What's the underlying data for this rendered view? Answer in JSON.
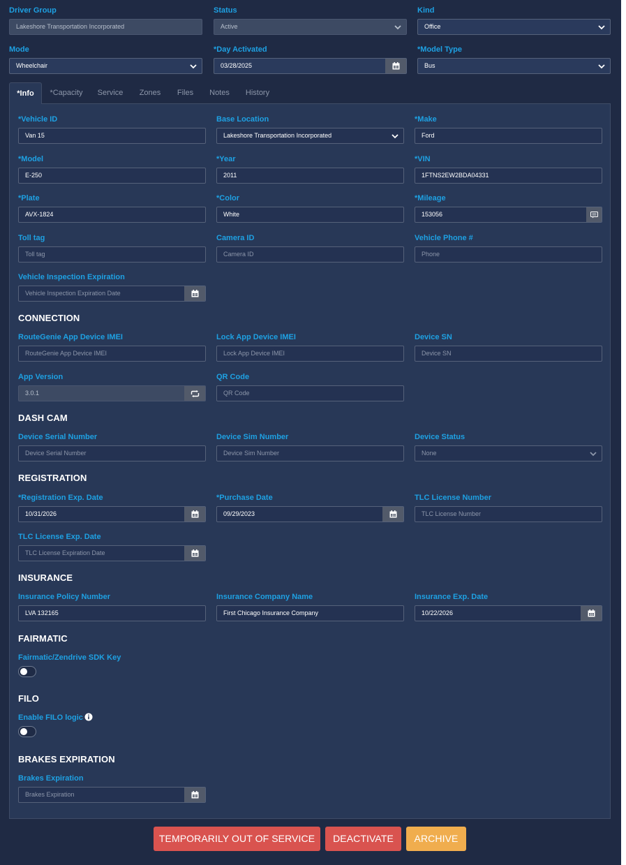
{
  "top": {
    "driver_group": {
      "label": "Driver Group",
      "value": "Lakeshore Transportation Incorporated"
    },
    "status": {
      "label": "Status",
      "value": "Active"
    },
    "kind": {
      "label": "Kind",
      "value": "Office"
    },
    "mode": {
      "label": "Mode",
      "value": "Wheelchair"
    },
    "day_activated": {
      "label": "*Day Activated",
      "value": "03/28/2025"
    },
    "model_type": {
      "label": "*Model Type",
      "value": "Bus"
    }
  },
  "tabs": [
    "*Info",
    "*Capacity",
    "Service",
    "Zones",
    "Files",
    "Notes",
    "History"
  ],
  "info": {
    "vehicle_id": {
      "label": "*Vehicle ID",
      "value": "Van 15"
    },
    "base_location": {
      "label": "Base Location",
      "value": "Lakeshore Transportation Incorporated"
    },
    "make": {
      "label": "*Make",
      "value": "Ford"
    },
    "model": {
      "label": "*Model",
      "value": "E-250"
    },
    "year": {
      "label": "*Year",
      "value": "2011"
    },
    "vin": {
      "label": "*VIN",
      "value": "1FTNS2EW2BDA04331"
    },
    "plate": {
      "label": "*Plate",
      "value": "AVX-1824"
    },
    "color": {
      "label": "*Color",
      "value": "White"
    },
    "mileage": {
      "label": "*Mileage",
      "value": "153056"
    },
    "toll_tag": {
      "label": "Toll tag",
      "placeholder": "Toll tag"
    },
    "camera_id": {
      "label": "Camera ID",
      "placeholder": "Camera ID"
    },
    "vehicle_phone": {
      "label": "Vehicle Phone #",
      "placeholder": "Phone"
    },
    "inspection": {
      "label": "Vehicle Inspection Expiration",
      "placeholder": "Vehicle Inspection Expiration Date"
    }
  },
  "connection": {
    "title": "CONNECTION",
    "routegenie_imei": {
      "label": "RouteGenie App Device IMEI",
      "placeholder": "RouteGenie App Device IMEI"
    },
    "lock_app_imei": {
      "label": "Lock App Device IMEI",
      "placeholder": "Lock App Device IMEI"
    },
    "device_sn": {
      "label": "Device SN",
      "placeholder": "Device SN"
    },
    "app_version": {
      "label": "App Version",
      "value": "3.0.1"
    },
    "qr_code": {
      "label": "QR Code",
      "placeholder": "QR Code"
    }
  },
  "dashcam": {
    "title": "DASH CAM",
    "serial": {
      "label": "Device Serial Number",
      "placeholder": "Device Serial Number"
    },
    "sim": {
      "label": "Device Sim Number",
      "placeholder": "Device Sim Number"
    },
    "status": {
      "label": "Device Status",
      "value": "None"
    }
  },
  "registration": {
    "title": "REGISTRATION",
    "exp_date": {
      "label": "*Registration Exp. Date",
      "value": "10/31/2026"
    },
    "purchase_date": {
      "label": "*Purchase Date",
      "value": "09/29/2023"
    },
    "tlc_number": {
      "label": "TLC License Number",
      "placeholder": "TLC License Number"
    },
    "tlc_exp": {
      "label": "TLC License Exp. Date",
      "placeholder": "TLC License Expiration Date"
    }
  },
  "insurance": {
    "title": "INSURANCE",
    "policy": {
      "label": "Insurance Policy Number",
      "value": "LVA 132165"
    },
    "company": {
      "label": "Insurance Company Name",
      "value": "First Chicago Insurance Company"
    },
    "exp_date": {
      "label": "Insurance Exp. Date",
      "value": "10/22/2026"
    }
  },
  "fairmatic": {
    "title": "FAIRMATIC",
    "sdk_key": {
      "label": "Fairmatic/Zendrive SDK Key",
      "enabled": false
    }
  },
  "filo": {
    "title": "FILO",
    "enable": {
      "label": "Enable FILO logic",
      "enabled": false
    }
  },
  "brakes": {
    "title": "BRAKES EXPIRATION",
    "expiration": {
      "label": "Brakes Expiration",
      "placeholder": "Brakes Expiration"
    }
  },
  "buttons": {
    "out_of_service": "TEMPORARILY OUT OF SERVICE",
    "deactivate": "DEACTIVATE",
    "archive": "ARCHIVE"
  },
  "colors": {
    "background": "#1f2a44",
    "label": "#1ea1e3",
    "danger": "#d9534f",
    "warning": "#f0ad4e"
  },
  "icons": {
    "calendar": "calendar-icon",
    "caret": "chevron-down-icon",
    "refresh": "refresh-icon",
    "message": "message-icon",
    "info": "info-icon"
  }
}
